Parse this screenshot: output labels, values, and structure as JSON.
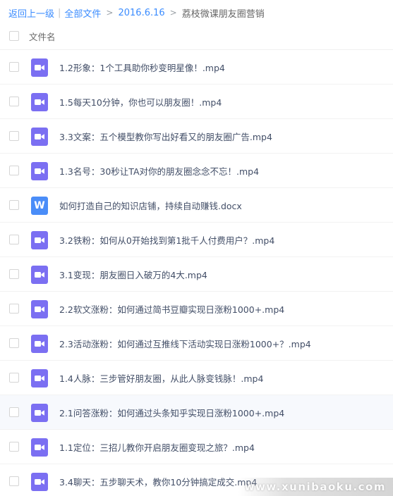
{
  "breadcrumb": {
    "back_label": "返回上一级",
    "separator": "|",
    "all_files_label": "全部文件",
    "arrow": ">",
    "folder_label": "2016.6.16",
    "current_label": "荔枝微课朋友圈营销"
  },
  "list_header": {
    "column_name": "文件名"
  },
  "files": [
    {
      "name": "1.2形象：1个工具助你秒变明星像！.mp4",
      "type": "video",
      "icon": "video-file-icon"
    },
    {
      "name": "1.5每天10分钟，你也可以朋友圈！.mp4",
      "type": "video",
      "icon": "video-file-icon"
    },
    {
      "name": "3.3文案：五个模型教你写出好看又的朋友圈广告.mp4",
      "type": "video",
      "icon": "video-file-icon"
    },
    {
      "name": "1.3名号：30秒让TA对你的朋友圈念念不忘！.mp4",
      "type": "video",
      "icon": "video-file-icon"
    },
    {
      "name": "如何打造自己的知识店铺，持续自动赚钱.docx",
      "type": "doc",
      "icon": "word-file-icon",
      "icon_letter": "W"
    },
    {
      "name": "3.2铁粉：如何从0开始找到第1批千人付费用户？.mp4",
      "type": "video",
      "icon": "video-file-icon"
    },
    {
      "name": "3.1变现：朋友圈日入破万的4大.mp4",
      "type": "video",
      "icon": "video-file-icon"
    },
    {
      "name": "2.2软文涨粉：如何通过简书豆瓣实现日涨粉1000+.mp4",
      "type": "video",
      "icon": "video-file-icon"
    },
    {
      "name": "2.3活动涨粉：如何通过互推线下活动实现日涨粉1000+？.mp4",
      "type": "video",
      "icon": "video-file-icon"
    },
    {
      "name": "1.4人脉：三步管好朋友圈，从此人脉变钱脉！.mp4",
      "type": "video",
      "icon": "video-file-icon"
    },
    {
      "name": "2.1问答涨粉：如何通过头条知乎实现日涨粉1000+.mp4",
      "type": "video",
      "icon": "video-file-icon",
      "highlighted": true
    },
    {
      "name": "1.1定位：三招儿教你开启朋友圈变现之旅？.mp4",
      "type": "video",
      "icon": "video-file-icon"
    },
    {
      "name": "3.4聊天：五步聊天术，教你10分钟搞定成交.mp4",
      "type": "video",
      "icon": "video-file-icon"
    }
  ],
  "watermark": "www.xunibaoku.com",
  "colors": {
    "link": "#3b8cff",
    "video_icon": "#7b6ff2",
    "word_icon": "#4a8df8",
    "file_name_text": "#424e67",
    "highlight_row": "#f7f9fd"
  }
}
